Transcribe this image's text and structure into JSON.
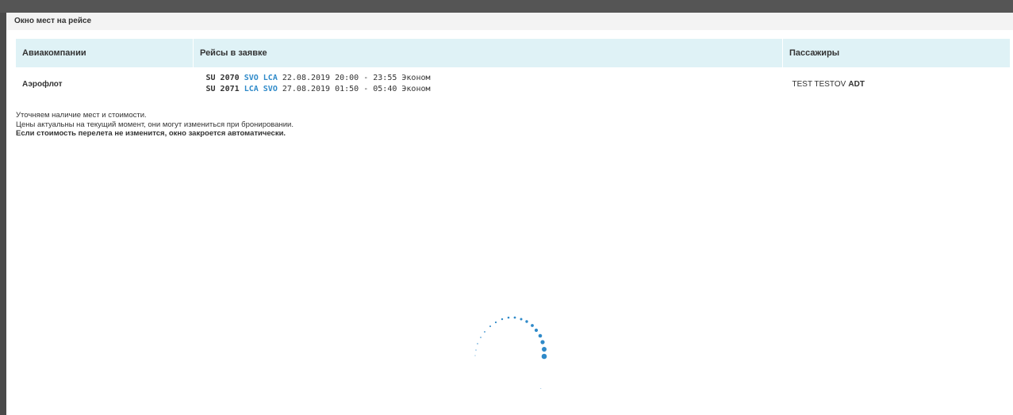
{
  "window": {
    "title": "Окно мест на рейсе"
  },
  "table": {
    "headers": {
      "airlines": "Авиакомпании",
      "flights": "Рейсы в заявке",
      "passengers": "Пассажиры"
    },
    "rows": [
      {
        "airline": "Аэрофлот",
        "segments": [
          {
            "flight": "SU 2070",
            "from": "SVO",
            "to": "LCA",
            "details": "22.08.2019 20:00 - 23:55 Эконом"
          },
          {
            "flight": "SU 2071",
            "from": "LCA",
            "to": "SVO",
            "details": "27.08.2019 01:50 - 05:40 Эконом"
          }
        ],
        "passenger": {
          "name": "TEST TESTOV",
          "type": "ADT"
        }
      }
    ]
  },
  "notes": {
    "line1": "Уточняем наличие мест и стоимости.",
    "line2": "Цены актуальны на текущий момент, они могут измениться при бронировании.",
    "line3": "Если стоимость перелета не изменится, окно закроется автоматически."
  },
  "colors": {
    "accent": "#2f8ac9",
    "header_bg": "#dff2f6",
    "backdrop": "#555555"
  },
  "icons": {
    "loader": "plane-loader-icon"
  }
}
